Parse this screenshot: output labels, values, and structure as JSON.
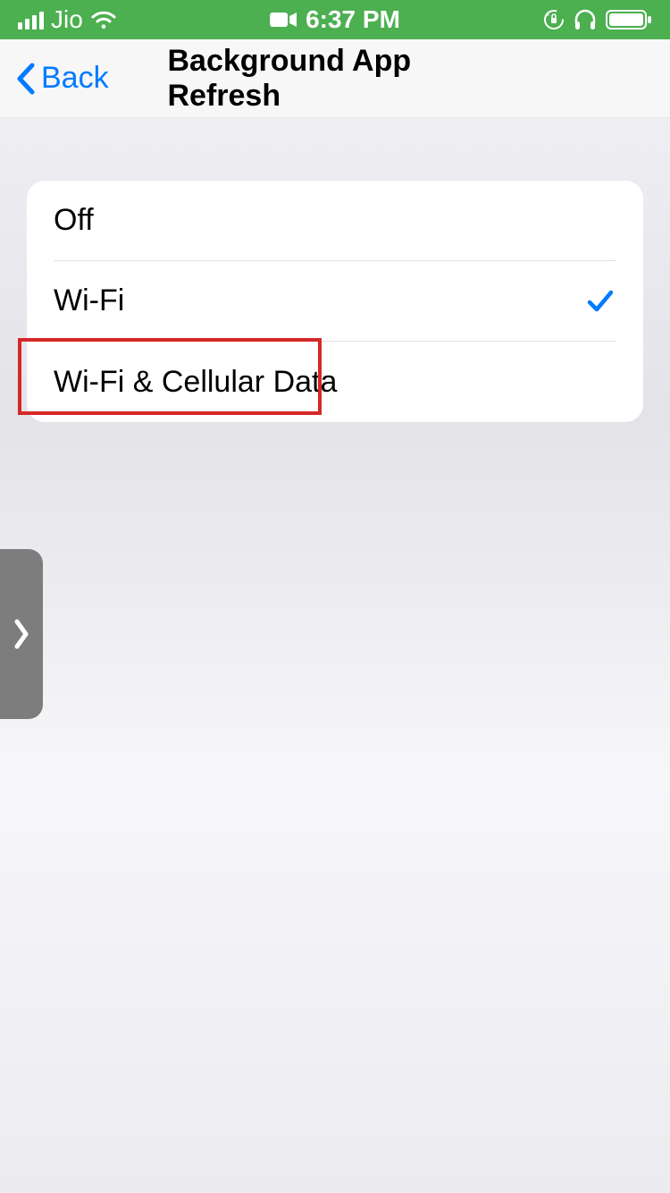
{
  "status_bar": {
    "carrier": "Jio",
    "time": "6:37 PM"
  },
  "nav": {
    "back_label": "Back",
    "title": "Background App Refresh"
  },
  "options": [
    {
      "label": "Off",
      "selected": false,
      "highlighted": false
    },
    {
      "label": "Wi-Fi",
      "selected": true,
      "highlighted": false
    },
    {
      "label": "Wi-Fi & Cellular Data",
      "selected": false,
      "highlighted": true
    }
  ],
  "colors": {
    "status_bar_bg": "#4CAF50",
    "accent": "#007AFF",
    "highlight": "#d62828"
  }
}
